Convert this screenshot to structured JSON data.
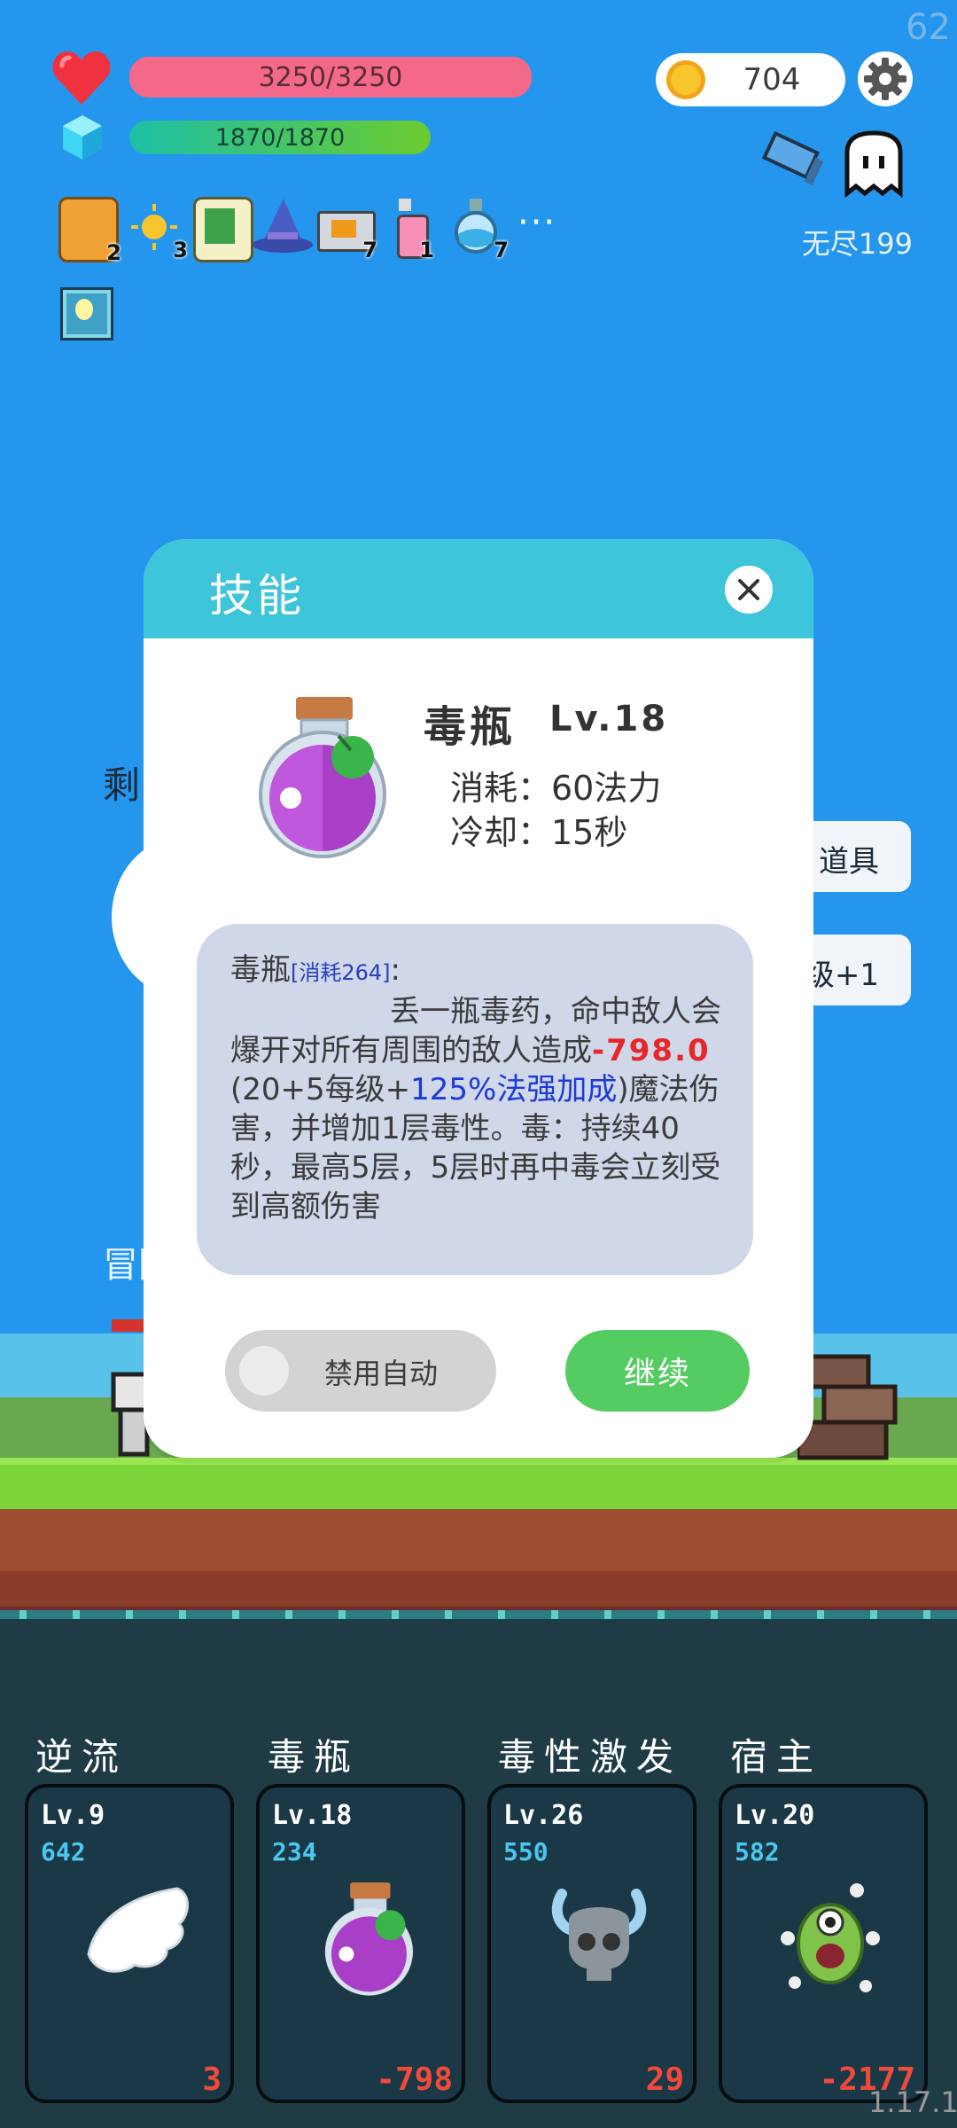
{
  "fps": "62",
  "version": "1.17.1",
  "hud": {
    "hp_text": "3250/3250",
    "hp_fraction": 1.0,
    "mp_text": "1870/1870",
    "mp_fraction": 1.0,
    "coins": "704",
    "mode_label": "无尽199"
  },
  "items": [
    {
      "icon": "book-icon",
      "count": "2"
    },
    {
      "icon": "sun-icon",
      "count": "3"
    },
    {
      "icon": "scroll-icon",
      "count": ""
    },
    {
      "icon": "wizard-hat-icon",
      "count": ""
    },
    {
      "icon": "briefcase-icon",
      "count": "7"
    },
    {
      "icon": "spray-bottle-icon",
      "count": "1"
    },
    {
      "icon": "flask-icon",
      "count": "7"
    }
  ],
  "more_label": "···",
  "background": {
    "left_text": "剩",
    "right_button_1": "道具",
    "right_button_2": "级+1",
    "adventurer_label": "冒险"
  },
  "dialog": {
    "title": "技能",
    "skill_name": "毒瓶",
    "skill_level": "Lv.18",
    "cost_line": "消耗：60法力",
    "cooldown_line": "冷却：15秒",
    "desc_head": "毒瓶",
    "desc_cost": "[消耗264]",
    "desc_colon": ":",
    "desc_part1": "丢一瓶毒药，命中敌人会爆开对所有周围的敌人造成",
    "desc_damage": "-798.0",
    "desc_part2": " (20+5每级+",
    "desc_bonus": "125%法强加成",
    "desc_part3": ")魔法伤害，并增加1层毒性。毒：持续40秒，最高5层，5层时再中毒会立刻受到高额伤害",
    "toggle_label": "禁用自动",
    "continue_label": "继续"
  },
  "skills": [
    {
      "name": "逆流",
      "level": "Lv.9",
      "cost": "642",
      "value": "3",
      "icon": "wing-icon"
    },
    {
      "name": "毒瓶",
      "level": "Lv.18",
      "cost": "234",
      "value": "-798",
      "icon": "poison-potion-icon"
    },
    {
      "name": "毒性激发",
      "level": "Lv.26",
      "cost": "550",
      "value": "29",
      "icon": "horned-skull-icon"
    },
    {
      "name": "宿主",
      "level": "Lv.20",
      "cost": "582",
      "value": "-2177",
      "icon": "monster-icon"
    }
  ],
  "colors": {
    "sky": "#2596ee",
    "dialog_header": "#3ec5d9",
    "continue": "#55cc62",
    "damage_red": "#e8262a"
  }
}
